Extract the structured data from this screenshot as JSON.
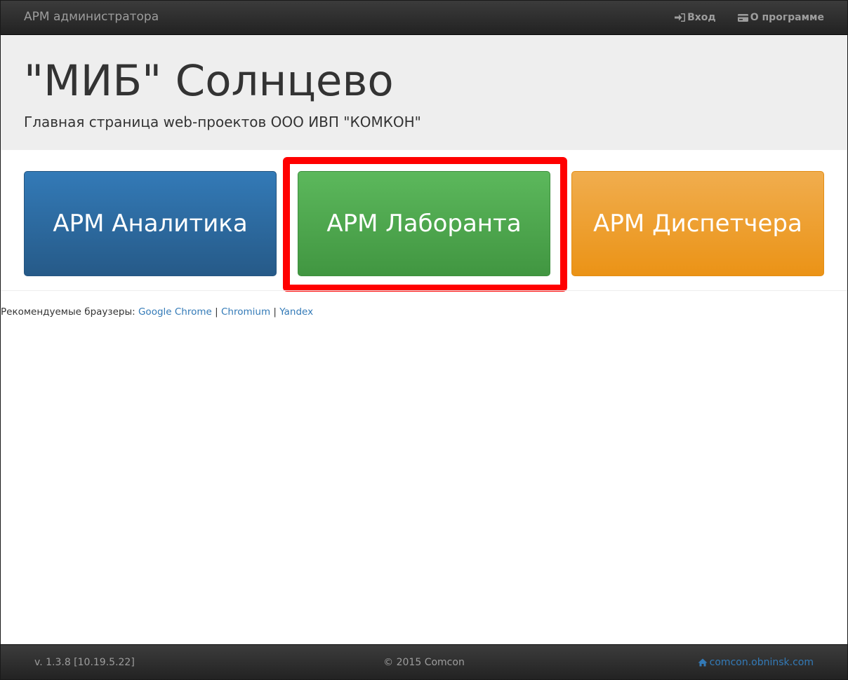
{
  "navbar": {
    "brand": "АРМ администратора",
    "login_label": "Вход",
    "login_icon": "log-in-icon",
    "about_label": "О программе",
    "about_icon": "credit-card-icon"
  },
  "jumbotron": {
    "title": "\"МИБ\" Солнцево",
    "subtitle": "Главная страница web-проектов ООО ИВП \"КОМКОН\""
  },
  "buttons": [
    {
      "label": "АРМ Аналитика",
      "color": "#337ab7"
    },
    {
      "label": "АРМ Лаборанта",
      "color": "#5cb85c",
      "highlighted": true
    },
    {
      "label": "АРМ Диспетчера",
      "color": "#f0ad4e"
    }
  ],
  "highlight_color": "#ff0000",
  "browsers": {
    "prefix": "Рекомендуемые браузеры:",
    "links": [
      "Google Chrome",
      "Chromium",
      "Yandex"
    ],
    "separator": "|"
  },
  "footer": {
    "version": "v. 1.3.8 [10.19.5.22]",
    "copyright": "© 2015 Comcon",
    "site_link": "comcon.obninsk.com",
    "site_icon": "home-icon"
  }
}
